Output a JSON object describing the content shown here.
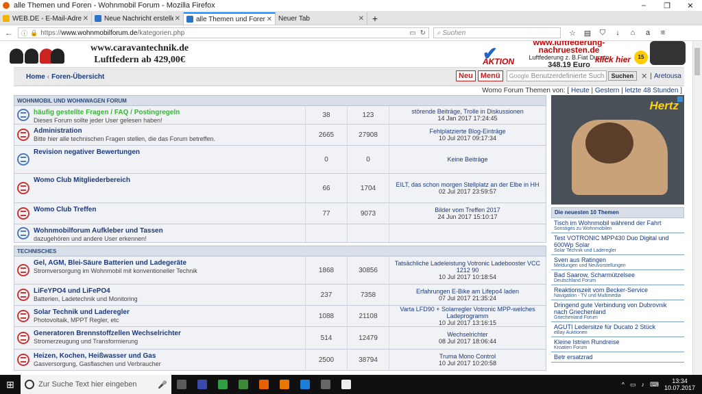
{
  "window": {
    "title": "alle Themen und Foren - Wohnmobil Forum - Mozilla Firefox",
    "minimize": "‒",
    "restore": "❐",
    "close": "✕"
  },
  "tabs": [
    {
      "label": "WEB.DE - E-Mail-Adresse ko",
      "color": "#f2b400"
    },
    {
      "label": "Neue Nachricht erstellen - F",
      "color": "#2a74c8"
    },
    {
      "label": "alle Themen und Foren - Wc",
      "color": "#2a74c8"
    },
    {
      "label": "Neuer Tab",
      "color": "#e3e3e3"
    }
  ],
  "tab_close": "✕",
  "newtab": "+",
  "nav": {
    "back": "←",
    "info": "ⓘ",
    "lock": "🔒",
    "url_prefix": "https://",
    "url_host": "www.wohnmobilforum.de",
    "url_path": "/kategorien.php",
    "reader": "▭",
    "reload": "↻",
    "search_placeholder": "Suchen",
    "icons": [
      "☆",
      "▤",
      "⛉",
      "↓",
      "⌂",
      "a",
      "≡"
    ]
  },
  "ads": {
    "left_line1": "www.caravantechnik.de",
    "left_line2": "Luftfedern ab 429,00€",
    "right_url": "www.luftfederung-nachruesten.de",
    "right_sub": "Luftfederung z. B.Fiat Ducato",
    "right_price": "348,19 Euro",
    "right_aktion": "AKTION",
    "right_klick": "klick hier",
    "right_badge": "15"
  },
  "breadcrumb": {
    "home": "Home",
    "sep": "‹",
    "current": "Foren-Übersicht"
  },
  "topnav": {
    "neu": "Neu",
    "menu": "Menü",
    "google": "Google",
    "search_placeholder": "Benutzerdefinierte Such",
    "suchen": "Suchen",
    "close": "✕",
    "sep": "|",
    "user": "Aretousa"
  },
  "themen": {
    "label": "Womo Forum Themen von:",
    "heute": "Heute",
    "gestern": "Gestern",
    "letzte": "letzte 48 Stunden",
    "sep": "|",
    "open": "[",
    "close": "]"
  },
  "sections": [
    {
      "title": "WOHNMOBIL UND WOHNWAGEN FORUM",
      "rows": [
        {
          "name": "häufig gestellte Fragen / FAQ / Postingregeln",
          "desc": "Dieses Forum sollte jeder User gelesen haben!",
          "topics": "38",
          "posts": "123",
          "last_title": "störende Beiträge, Trolle in Diskussionen",
          "last_date": "14 Jan 2017 17:24:45",
          "green": true,
          "icon": "blue"
        },
        {
          "name": "Administration",
          "desc": "Bitte hier alle technischen Fragen stellen, die das Forum betreffen.",
          "topics": "2665",
          "posts": "27908",
          "last_title": "Fehlplatzierte Blog-Einträge",
          "last_date": "10 Jul 2017 09:17:34",
          "green": false,
          "icon": "red"
        },
        {
          "name": "Revision negativer Bewertungen",
          "desc": "",
          "topics": "0",
          "posts": "0",
          "last_title": "Keine Beiträge",
          "last_date": "",
          "green": false,
          "icon": "blue"
        },
        {
          "name": "Womo Club Mitgliederbereich",
          "desc": "",
          "topics": "66",
          "posts": "1704",
          "last_title": "EILT, das schon morgen Stellplatz an der Elbe in HH",
          "last_date": "02 Jul 2017 23:59:57",
          "green": false,
          "icon": "red"
        },
        {
          "name": "Womo Club Treffen",
          "desc": "",
          "topics": "77",
          "posts": "9073",
          "last_title": "Bilder vom Treffen 2017",
          "last_date": "24 Jun 2017 15:10:17",
          "green": false,
          "icon": "red"
        },
        {
          "name": "Wohnmobilforum Aufkleber und Tassen",
          "desc": "dazugehören und andere User erkennen!",
          "topics": "",
          "posts": "",
          "last_title": "",
          "last_date": "",
          "green": false,
          "icon": "blue"
        }
      ]
    },
    {
      "title": "TECHNISCHES",
      "rows": [
        {
          "name": "Gel, AGM, Blei-Säure Batterien und Ladegeräte",
          "desc": "Stromversorgung im Wohnmobil mit konventioneller Technik",
          "topics": "1868",
          "posts": "30856",
          "last_title": "Tatsächliche Ladeleistung Votronic Ladebooster VCC 1212 90",
          "last_date": "10 Jul 2017 10:18:54",
          "green": false,
          "icon": "red"
        },
        {
          "name": "LiFeYPO4 und LiFePO4",
          "desc": "Batterien, Ladetechnik und Monitoring",
          "topics": "237",
          "posts": "7358",
          "last_title": "Erfahrungen E-Bike am Lifepo4 laden",
          "last_date": "07 Jul 2017 21:35:24",
          "green": false,
          "icon": "red"
        },
        {
          "name": "Solar Technik und Laderegler",
          "desc": "Photovoltaik, MPPT Regler, etc",
          "topics": "1088",
          "posts": "21108",
          "last_title": "Varta LFD90 + Solarregler Votronic MPP-welches Ladeprogramm",
          "last_date": "10 Jul 2017 13:16:15",
          "green": false,
          "icon": "red"
        },
        {
          "name": "Generatoren Brennstoffzellen Wechselrichter",
          "desc": "Stromerzeugung und Transformierung",
          "topics": "514",
          "posts": "12479",
          "last_title": "Wechselrichter",
          "last_date": "08 Jul 2017 18:06:44",
          "green": false,
          "icon": "red"
        },
        {
          "name": "Heizen, Kochen, Heißwasser und Gas",
          "desc": "Gasversorgung, Gasflaschen und Verbraucher",
          "topics": "2500",
          "posts": "38794",
          "last_title": "Truma Mono Control",
          "last_date": "10 Jul 2017 10:20:58",
          "green": false,
          "icon": "red"
        }
      ]
    }
  ],
  "sidebar": {
    "ad_logo": "Hertz",
    "head": "Die neuesten 10 Themen",
    "items": [
      {
        "title": "Tisch im Wohnmobil während der Fahrt",
        "cat": "Sonstiges zu Wohnmobilen"
      },
      {
        "title": "Test VOTRONIC MPP430 Duo Digital und 600Wp Solar",
        "cat": "Solar Technik und Laderegler"
      },
      {
        "title": "Sven aus Ratingen",
        "cat": "Meldungen und Neuvorstellungen"
      },
      {
        "title": "Bad Saarow, Scharmützelsee",
        "cat": "Deutschland Forum"
      },
      {
        "title": "Reaktionszeit vom Becker-Service",
        "cat": "Navigation - TV und Multimedia"
      },
      {
        "title": "Dringend gute Verbindung von Dubrovnik nach Griechenland",
        "cat": "Griechenland Forum"
      },
      {
        "title": "AGUTI Ledersitze für Ducato 2 Stück",
        "cat": "eBay Auktionen"
      },
      {
        "title": "Kleine Istrien Rundreise",
        "cat": "Kroatien Forum"
      },
      {
        "title": "Betr ersatzrad",
        "cat": ""
      }
    ]
  },
  "taskbar": {
    "start": "⊞",
    "mic": "🎤",
    "search_placeholder": "Zur Suche Text hier eingeben",
    "apps": [
      "#5a5a5a",
      "#3a4aa8",
      "#2f9e44",
      "#3a8a3a",
      "#e66000",
      "#e67700",
      "#1c7ed6",
      "#666666",
      "#eeeeee"
    ],
    "tray": [
      "^",
      "▭",
      "♪",
      "⌨"
    ],
    "time": "13:34",
    "date": "10.07.2017"
  }
}
